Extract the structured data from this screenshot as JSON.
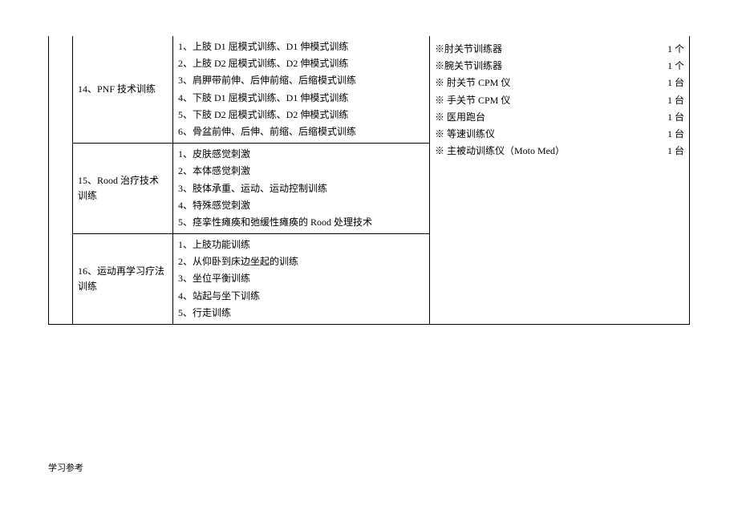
{
  "rows": [
    {
      "label": "14、PNF 技术训练",
      "items": [
        "1、上肢 D1 屈模式训练、D1 伸模式训练",
        "2、上肢 D2 屈模式训练、D2 伸模式训练",
        "3、肩胛带前伸、后伸前缩、后缩模式训练",
        "4、下肢 D1 屈模式训练、D1 伸模式训练",
        "5、下肢 D2 屈模式训练、D2 伸模式训练",
        "6、骨盆前伸、后伸、前缩、后缩模式训练"
      ]
    },
    {
      "label": "15、Rood 治疗技术训练",
      "items": [
        "1、皮肤感觉刺激",
        "2、本体感觉刺激",
        "3、肢体承重、运动、运动控制训练",
        "4、特殊感觉刺激",
        "5、痉挛性瘫痪和弛缓性瘫痪的 Rood 处理技术"
      ]
    },
    {
      "label": "16、运动再学习疗法训练",
      "items": [
        "1、上肢功能训练",
        "2、从仰卧到床边坐起的训练",
        "3、坐位平衡训练",
        "4、站起与坐下训练",
        "5、行走训练"
      ]
    }
  ],
  "equipment": [
    {
      "label": "※肘关节训练器",
      "qty": "1 个"
    },
    {
      "label": "※腕关节训练器",
      "qty": "1 个"
    },
    {
      "label": "※ 肘关节 CPM 仪",
      "qty": "1 台"
    },
    {
      "label": "※ 手关节 CPM 仪",
      "qty": "1 台"
    },
    {
      "label": "※ 医用跑台",
      "qty": "1 台"
    },
    {
      "label": "※ 等速训练仪",
      "qty": "1 台"
    },
    {
      "label": "※ 主被动训练仪（Moto Med）",
      "qty": "1 台"
    }
  ],
  "footer": "学习参考"
}
